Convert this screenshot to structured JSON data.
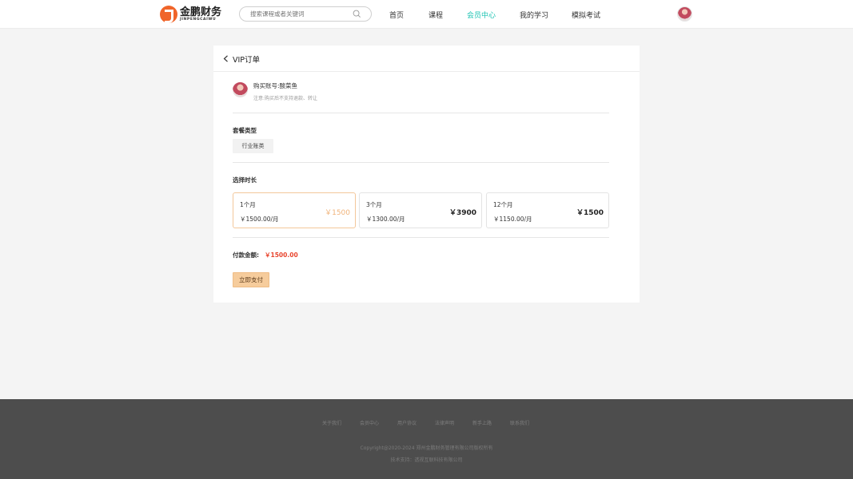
{
  "header": {
    "logo": {
      "cn": "金鹏财务",
      "en": "JINPENGCAIWU"
    },
    "search": {
      "placeholder": "搜索课程或者关键词"
    },
    "nav": [
      {
        "label": "首页",
        "active": false
      },
      {
        "label": "课程",
        "active": false
      },
      {
        "label": "会员中心",
        "active": true
      },
      {
        "label": "我的学习",
        "active": false
      },
      {
        "label": "模拟考试",
        "active": false
      }
    ],
    "accent_color": "#1cc3b2"
  },
  "order": {
    "title": "VIP订单",
    "account": {
      "name_line": "购买账号:酸菜鱼",
      "note": "注意:购买后不支持退款、转让"
    },
    "package_section": {
      "label": "套餐类型",
      "selected": "行业账类"
    },
    "duration_section": {
      "label": "选择时长",
      "options": [
        {
          "name": "1个月",
          "unit_price": "￥1500.00/月",
          "total": "￥1500",
          "selected": true
        },
        {
          "name": "3个月",
          "unit_price": "￥1300.00/月",
          "total": "￥3900",
          "selected": false
        },
        {
          "name": "12个月",
          "unit_price": "￥1150.00/月",
          "total": "￥1500",
          "selected": false
        }
      ]
    },
    "payment": {
      "label": "付款金额:",
      "amount": "￥1500.00",
      "button": "立即支付",
      "amount_color": "#e8452e"
    }
  },
  "footer": {
    "links": [
      "关于我们",
      "会员中心",
      "用户协议",
      "法律声明",
      "新手上路",
      "联系我们"
    ],
    "copyright": "Copyright@2020-2024 郑州金鹏财务管理有限公司版权所有",
    "support": "技术支持：透视互联科技有限公司"
  }
}
